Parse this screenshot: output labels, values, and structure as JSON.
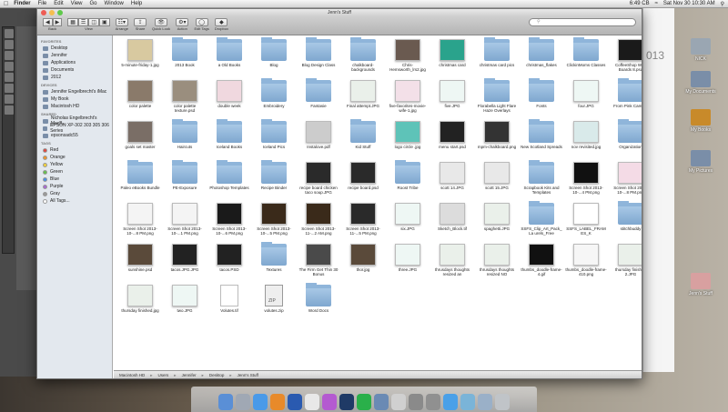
{
  "menubar": {
    "app": "Finder",
    "menus": [
      "File",
      "Edit",
      "View",
      "Go",
      "Window",
      "Help"
    ],
    "battery": "6:49 CB",
    "clock": "Sat Nov 30  10:30 AM"
  },
  "window": {
    "title": "Jenn's Stuff"
  },
  "toolbar": {
    "back": "Back",
    "view": "View",
    "arrange": "Arrange",
    "action": "Action",
    "share": "Share",
    "quicklook": "Quick Look",
    "edit_tags": "Edit Tags",
    "dropbox": "Dropbox",
    "search_placeholder": ""
  },
  "sidebar": {
    "favorites_title": "FAVORITES",
    "favorites": [
      "Desktop",
      "Jennifer",
      "Applications",
      "Documents",
      "2012"
    ],
    "devices_title": "DEVICES",
    "devices": [
      "Jennifer Engelbrecht's iMac",
      "My Book",
      "Macintosh HD"
    ],
    "shared_title": "SHARED",
    "shared": [
      "Nicholas Engelbrecht's MacB...",
      "EPSON XP-302 303 305 306 Series",
      "epsonsadc55"
    ],
    "tags_title": "TAGS",
    "tags": [
      {
        "name": "Red",
        "color": "#e0473f"
      },
      {
        "name": "Orange",
        "color": "#f0952b"
      },
      {
        "name": "Yellow",
        "color": "#f3d23c"
      },
      {
        "name": "Green",
        "color": "#66c04d"
      },
      {
        "name": "Blue",
        "color": "#4a8ee6"
      },
      {
        "name": "Purple",
        "color": "#a86bd1"
      },
      {
        "name": "Gray",
        "color": "#9a9a9a"
      },
      {
        "name": "All Tags...",
        "color": "#ffffff"
      }
    ]
  },
  "files": [
    {
      "name": "5-minute-friday-1.jpg",
      "kind": "image",
      "color": "#d8c9a0"
    },
    {
      "name": "2013 Book",
      "kind": "folder"
    },
    {
      "name": "a Old Books",
      "kind": "folder"
    },
    {
      "name": "Blog",
      "kind": "folder"
    },
    {
      "name": "Blog Design Class",
      "kind": "folder"
    },
    {
      "name": "chalkboard-backgrounds",
      "kind": "folder"
    },
    {
      "name": "Chris-Hemsworth_lrs2.jpg",
      "kind": "image",
      "color": "#6a5a50"
    },
    {
      "name": "christmas card",
      "kind": "image",
      "color": "#2aa38c"
    },
    {
      "name": "christmas card pics",
      "kind": "folder"
    },
    {
      "name": "christmas_flakes",
      "kind": "folder"
    },
    {
      "name": "ClickinMoms Classes",
      "kind": "folder"
    },
    {
      "name": "CoffeeShop Web Boards 8.psd",
      "kind": "image",
      "color": "#1a1a1a"
    },
    {
      "name": "color palette",
      "kind": "image",
      "color": "#8a7a6a"
    },
    {
      "name": "color palette texture.psd",
      "kind": "image",
      "color": "#9a8e7e"
    },
    {
      "name": "double week",
      "kind": "image",
      "color": "#f0d8df"
    },
    {
      "name": "Embroidery",
      "kind": "folder"
    },
    {
      "name": "Fantasie",
      "kind": "folder"
    },
    {
      "name": "Final attempt.JPG",
      "kind": "image",
      "color": "#eaf0ea"
    },
    {
      "name": "five-favorites-movie-wife-1.jpg",
      "kind": "image",
      "color": "#f3e0e8"
    },
    {
      "name": "five.JPG",
      "kind": "image",
      "color": "#eef7f4"
    },
    {
      "name": "Florabella Light Flare Haze Overlays",
      "kind": "folder"
    },
    {
      "name": "Fonts",
      "kind": "folder"
    },
    {
      "name": "four.JPG",
      "kind": "image",
      "color": "#eef7f4"
    },
    {
      "name": "From Pink Camera",
      "kind": "folder"
    },
    {
      "name": "goals set master",
      "kind": "image",
      "color": "#7a6e66"
    },
    {
      "name": "Haircuts",
      "kind": "folder"
    },
    {
      "name": "Iceland Books",
      "kind": "folder"
    },
    {
      "name": "Iceland Pics",
      "kind": "folder"
    },
    {
      "name": "Instalove.pdf",
      "kind": "image",
      "color": "#cccccc"
    },
    {
      "name": "Kid Stuff",
      "kind": "folder"
    },
    {
      "name": "logo circle .jpg",
      "kind": "image",
      "color": "#5ec3b8"
    },
    {
      "name": "menu start.psd",
      "kind": "image",
      "color": "#222222"
    },
    {
      "name": "mpm-chalkboard.png",
      "kind": "image",
      "color": "#333333"
    },
    {
      "name": "New Scotland Spreads",
      "kind": "folder"
    },
    {
      "name": "nov revisited.jpg",
      "kind": "image",
      "color": "#d9eaea"
    },
    {
      "name": "Organization",
      "kind": "folder"
    },
    {
      "name": "Paleo eBooks Bundle",
      "kind": "folder"
    },
    {
      "name": "PE-Exposure",
      "kind": "folder"
    },
    {
      "name": "Photoshop Templates",
      "kind": "folder"
    },
    {
      "name": "Recipe Binder",
      "kind": "folder"
    },
    {
      "name": "recipe board chicken taco soup.JPG",
      "kind": "image",
      "color": "#2a2a2a"
    },
    {
      "name": "recipe board.psd",
      "kind": "image",
      "color": "#2a2a2a"
    },
    {
      "name": "Roost Tribe",
      "kind": "folder"
    },
    {
      "name": "scott 14.JPG",
      "kind": "image",
      "color": "#e8e8e8"
    },
    {
      "name": "scott 15.JPG",
      "kind": "image",
      "color": "#e8e8e8"
    },
    {
      "name": "Scrapbook Kits and Templates",
      "kind": "folder"
    },
    {
      "name": "Screen Shot 2013-10-...4 PM.png",
      "kind": "image",
      "color": "#111111"
    },
    {
      "name": "Screen Shot 2013-10-...8 PM.png",
      "kind": "image",
      "color": "#f4dbe6"
    },
    {
      "name": "Screen Shot 2013-10-...8 PM.png",
      "kind": "image",
      "color": "#f4f4f4"
    },
    {
      "name": "Screen Shot 2013-10-...1 PM.png",
      "kind": "image",
      "color": "#f4f4f4"
    },
    {
      "name": "Screen Shot 2013-10-...6 PM.png",
      "kind": "image",
      "color": "#1a1a1a"
    },
    {
      "name": "Screen Shot 2013-10-...5 PM.png",
      "kind": "image",
      "color": "#3a2a1a"
    },
    {
      "name": "Screen Shot 2013-11-...2 AM.png",
      "kind": "image",
      "color": "#3a2a1a"
    },
    {
      "name": "Screen Shot 2013-11-...5 PM.png",
      "kind": "image",
      "color": "#2a2a2a"
    },
    {
      "name": "six.JPG",
      "kind": "image",
      "color": "#eef7f4"
    },
    {
      "name": "Sketch_Block.tif",
      "kind": "image",
      "color": "#dcdcdc"
    },
    {
      "name": "spaghetti.JPG",
      "kind": "image",
      "color": "#eaf0ea"
    },
    {
      "name": "SSFS_Clip_Art_Pack_La urels_Free",
      "kind": "folder"
    },
    {
      "name": "SSFS_LABEL_FRAMES_K IT_7_Freebie.png",
      "kind": "image",
      "color": "#ffffff"
    },
    {
      "name": "stitchbuddy",
      "kind": "folder"
    },
    {
      "name": "sunshine.psd",
      "kind": "image",
      "color": "#5a4a3a"
    },
    {
      "name": "tacos.JPG.JPG",
      "kind": "image",
      "color": "#222222"
    },
    {
      "name": "tacos.PSD",
      "kind": "image",
      "color": "#222222"
    },
    {
      "name": "Textures",
      "kind": "folder"
    },
    {
      "name": "The Firm Get Thin 30 Bonus (autosaved).mov",
      "kind": "image",
      "color": "#4a4a4a"
    },
    {
      "name": "thor.jpg",
      "kind": "image",
      "color": "#5a4a3a"
    },
    {
      "name": "three.JPG",
      "kind": "image",
      "color": "#eef7f4"
    },
    {
      "name": "thrusdays thoughts resized an ...owed.JPG",
      "kind": "image",
      "color": "#eaf0ea"
    },
    {
      "name": "thrusdays thoughts resized NO shadow.JPG",
      "kind": "image",
      "color": "#eaf0ea"
    },
    {
      "name": "thumbs_doodle-frame-4.gif",
      "kind": "image",
      "color": "#111111"
    },
    {
      "name": "thumbs_doodle-frame-410.png",
      "kind": "image",
      "color": "#f6f6f6"
    },
    {
      "name": "thursday finished 2.JPG",
      "kind": "image",
      "color": "#eaf0ea"
    },
    {
      "name": "thursday finished.jpg",
      "kind": "image",
      "color": "#eaf0ea"
    },
    {
      "name": "two.JPG",
      "kind": "image",
      "color": "#eef7f4"
    },
    {
      "name": "Volutes.tif",
      "kind": "doc"
    },
    {
      "name": "volutes.zip",
      "kind": "zip"
    },
    {
      "name": "Word Docs",
      "kind": "folder"
    }
  ],
  "pathbar": [
    "Macintosh HD",
    "Users",
    "Jennifer",
    "Desktop",
    "Jenn's Stuff"
  ],
  "desktop_icons": [
    {
      "name": "NICK",
      "color": "#9aa6b2"
    },
    {
      "name": "My Documents",
      "color": "#7a8ea8"
    },
    {
      "name": "My Books",
      "color": "#c88a2a"
    },
    {
      "name": "My Pictures",
      "color": "#7a8ea8"
    },
    {
      "name": "Jenn's Stuff",
      "color": "#d8a0a0"
    }
  ],
  "calendar_year": "013"
}
